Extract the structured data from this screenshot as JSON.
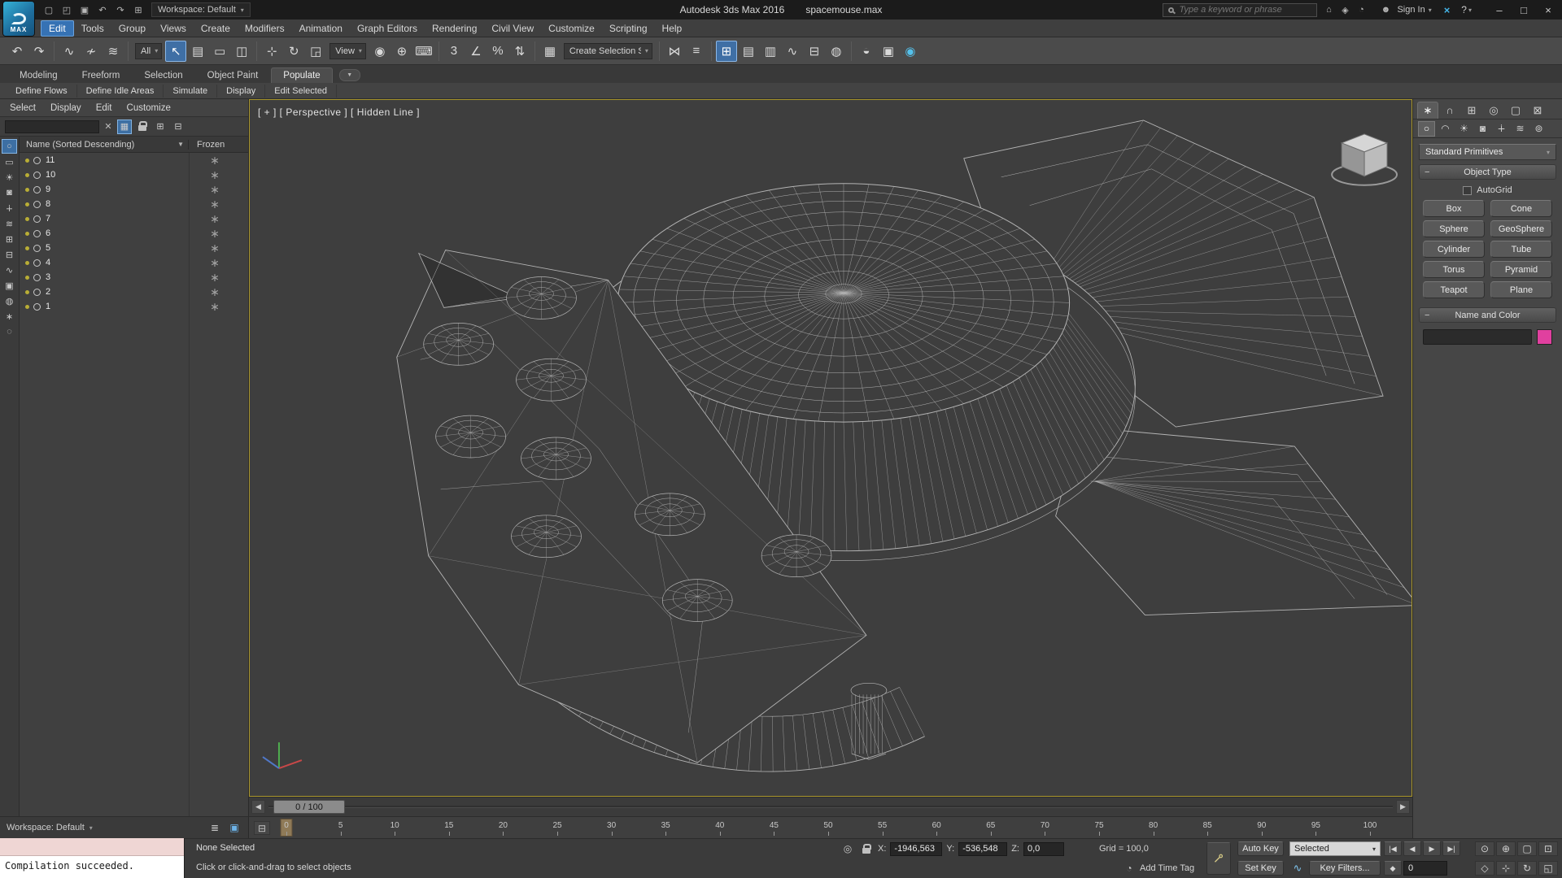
{
  "titlebar": {
    "logo_text": "MAX",
    "quick_icons": [
      {
        "name": "new-scene-icon",
        "glyph": "▢"
      },
      {
        "name": "open-file-icon",
        "glyph": "◰"
      },
      {
        "name": "save-file-icon",
        "glyph": "▣"
      },
      {
        "name": "undo-quick-icon",
        "glyph": "↶"
      },
      {
        "name": "redo-quick-icon",
        "glyph": "↷"
      },
      {
        "name": "project-folder-icon",
        "glyph": "⊞"
      }
    ],
    "workspace_label": "Workspace: Default",
    "app_title": "Autodesk 3ds Max 2016",
    "file_title": "spacemouse.max",
    "search_placeholder": "Type a keyword or phrase",
    "right_icons": [
      {
        "name": "home-icon",
        "glyph": "⌂"
      },
      {
        "name": "favorites-icon",
        "glyph": "◈"
      },
      {
        "name": "notifications-icon",
        "glyph": "◔"
      }
    ],
    "avatar_glyph": "☻",
    "sign_in": "Sign In",
    "feedback_icon": "×",
    "help_label": "?",
    "window_buttons": {
      "minimize": "–",
      "maximize": "□",
      "close": "×"
    }
  },
  "menubar": {
    "items": [
      {
        "label": "Edit",
        "active": true
      },
      {
        "label": "Tools"
      },
      {
        "label": "Group"
      },
      {
        "label": "Views"
      },
      {
        "label": "Create"
      },
      {
        "label": "Modifiers"
      },
      {
        "label": "Animation"
      },
      {
        "label": "Graph Editors"
      },
      {
        "label": "Rendering"
      },
      {
        "label": "Civil View"
      },
      {
        "label": "Customize"
      },
      {
        "label": "Scripting"
      },
      {
        "label": "Help"
      }
    ]
  },
  "toolbar": {
    "items": [
      {
        "type": "icon",
        "name": "undo-icon",
        "glyph": "↶"
      },
      {
        "type": "icon",
        "name": "redo-icon",
        "glyph": "↷"
      },
      {
        "type": "sep"
      },
      {
        "type": "icon",
        "name": "select-and-link-icon",
        "glyph": "∿"
      },
      {
        "type": "icon",
        "name": "unlink-selection-icon",
        "glyph": "≁"
      },
      {
        "type": "icon",
        "name": "bind-to-space-warp-icon",
        "glyph": "≋"
      },
      {
        "type": "sep"
      },
      {
        "type": "dropdown",
        "name": "selection-filter-dropdown",
        "value": "All"
      },
      {
        "type": "icon",
        "name": "select-object-icon",
        "glyph": "↖",
        "active": true
      },
      {
        "type": "icon",
        "name": "select-by-name-icon",
        "glyph": "▤"
      },
      {
        "type": "icon",
        "name": "selection-region-icon",
        "glyph": "▭"
      },
      {
        "type": "icon",
        "name": "window-crossing-icon",
        "glyph": "◫"
      },
      {
        "type": "sep"
      },
      {
        "type": "icon",
        "name": "select-and-move-icon",
        "glyph": "⊹"
      },
      {
        "type": "icon",
        "name": "select-and-rotate-icon",
        "glyph": "↻"
      },
      {
        "type": "icon",
        "name": "select-and-scale-icon",
        "glyph": "◲"
      },
      {
        "type": "dropdown",
        "name": "reference-coordinate-dropdown",
        "value": "View"
      },
      {
        "type": "icon",
        "name": "use-center-icon",
        "glyph": "◉"
      },
      {
        "type": "icon",
        "name": "select-and-manipulate-icon",
        "glyph": "⊕"
      },
      {
        "type": "icon",
        "name": "keyboard-override-icon",
        "glyph": "⌨"
      },
      {
        "type": "sep"
      },
      {
        "type": "icon",
        "name": "snap-toggle-3d-icon",
        "glyph": "3"
      },
      {
        "type": "icon",
        "name": "angle-snap-icon",
        "glyph": "∠"
      },
      {
        "type": "icon",
        "name": "percent-snap-icon",
        "glyph": "%"
      },
      {
        "type": "icon",
        "name": "spinner-snap-icon",
        "glyph": "⇅"
      },
      {
        "type": "sep"
      },
      {
        "type": "icon",
        "name": "edit-named-selections-icon",
        "glyph": "▦"
      },
      {
        "type": "combo",
        "name": "named-selection-combo",
        "value": "Create Selection Set"
      },
      {
        "type": "sep"
      },
      {
        "type": "icon",
        "name": "mirror-icon",
        "glyph": "⋈"
      },
      {
        "type": "icon",
        "name": "align-icon",
        "glyph": "≡"
      },
      {
        "type": "sep"
      },
      {
        "type": "icon",
        "name": "toggle-scene-explorer-icon",
        "glyph": "⊞",
        "active": true
      },
      {
        "type": "icon",
        "name": "layer-manager-icon",
        "glyph": "▤"
      },
      {
        "type": "icon",
        "name": "ribbon-toggle-icon",
        "glyph": "▥"
      },
      {
        "type": "icon",
        "name": "curve-editor-icon",
        "glyph": "∿"
      },
      {
        "type": "icon",
        "name": "schematic-view-icon",
        "glyph": "⊟"
      },
      {
        "type": "icon",
        "name": "material-editor-icon",
        "glyph": "◍"
      },
      {
        "type": "sep"
      },
      {
        "type": "icon",
        "name": "render-setup-icon",
        "glyph": "◒"
      },
      {
        "type": "icon",
        "name": "rendered-frame-icon",
        "glyph": "▣"
      },
      {
        "type": "icon",
        "name": "render-production-icon",
        "glyph": "◉",
        "accent": true
      }
    ]
  },
  "ribbon": {
    "tabs": [
      {
        "label": "Modeling"
      },
      {
        "label": "Freeform"
      },
      {
        "label": "Selection"
      },
      {
        "label": "Object Paint"
      },
      {
        "label": "Populate",
        "active": true
      }
    ],
    "tools": [
      {
        "label": "Define Flows"
      },
      {
        "label": "Define Idle Areas"
      },
      {
        "label": "Simulate"
      },
      {
        "label": "Display"
      },
      {
        "label": "Edit Selected"
      }
    ]
  },
  "scene_explorer": {
    "menus": [
      {
        "label": "Select"
      },
      {
        "label": "Display"
      },
      {
        "label": "Edit"
      },
      {
        "label": "Customize"
      }
    ],
    "search_placeholder": "",
    "clear_glyph": "✕",
    "name_column": "Name (Sorted Descending)",
    "frozen_column": "Frozen",
    "frozen_glyph": "∗",
    "rows": [
      {
        "label": "11"
      },
      {
        "label": "10"
      },
      {
        "label": "9"
      },
      {
        "label": "8"
      },
      {
        "label": "7"
      },
      {
        "label": "6"
      },
      {
        "label": "5"
      },
      {
        "label": "4"
      },
      {
        "label": "3"
      },
      {
        "label": "2"
      },
      {
        "label": "1"
      }
    ],
    "search_icons": [
      {
        "name": "find-filter-icon",
        "glyph": "▦",
        "active": true
      },
      {
        "name": "lock-explorer-icon",
        "glyph": "lock"
      },
      {
        "name": "add-filter-icon",
        "glyph": "⊞"
      },
      {
        "name": "remove-filter-icon",
        "glyph": "⊟"
      }
    ],
    "strip_icons": [
      {
        "name": "display-geometry-filter-icon",
        "glyph": "○",
        "active": true
      },
      {
        "name": "display-shapes-filter-icon",
        "glyph": "▭"
      },
      {
        "name": "display-lights-filter-icon",
        "glyph": "☀"
      },
      {
        "name": "display-cameras-filter-icon",
        "glyph": "◙"
      },
      {
        "name": "display-helpers-filter-icon",
        "glyph": "∔"
      },
      {
        "name": "display-spacewarps-filter-icon",
        "glyph": "≋"
      },
      {
        "name": "display-groups-filter-icon",
        "glyph": "⊞"
      },
      {
        "name": "display-xrefs-filter-icon",
        "glyph": "⊟"
      },
      {
        "name": "display-bones-filter-icon",
        "glyph": "∿"
      },
      {
        "name": "display-containers-filter-icon",
        "glyph": "▣"
      },
      {
        "name": "display-materials-filter-icon",
        "glyph": "◍"
      },
      {
        "name": "display-frozen-filter-icon",
        "glyph": "∗"
      },
      {
        "name": "display-hidden-filter-icon",
        "glyph": "◌"
      }
    ]
  },
  "viewport": {
    "label": "[ + ] [ Perspective ] [ Hidden Line ]"
  },
  "command_panel": {
    "tabs": [
      {
        "name": "create-tab-icon",
        "glyph": "∗",
        "active": true
      },
      {
        "name": "modify-tab-icon",
        "glyph": "∩"
      },
      {
        "name": "hierarchy-tab-icon",
        "glyph": "⊞"
      },
      {
        "name": "motion-tab-icon",
        "glyph": "◎"
      },
      {
        "name": "display-tab-icon",
        "glyph": "▢"
      },
      {
        "name": "utilities-tab-icon",
        "glyph": "⊠"
      }
    ],
    "categories": [
      {
        "name": "geometry-category-icon",
        "glyph": "○",
        "active": true
      },
      {
        "name": "shapes-category-icon",
        "glyph": "◠"
      },
      {
        "name": "lights-category-icon",
        "glyph": "☀"
      },
      {
        "name": "cameras-category-icon",
        "glyph": "◙"
      },
      {
        "name": "helpers-category-icon",
        "glyph": "∔"
      },
      {
        "name": "spacewarps-category-icon",
        "glyph": "≋"
      },
      {
        "name": "systems-category-icon",
        "glyph": "⊚"
      }
    ],
    "category_dropdown": "Standard Primitives",
    "object_type_rollout": "Object Type",
    "autogrid_label": "AutoGrid",
    "object_buttons": [
      {
        "label": "Box"
      },
      {
        "label": "Cone"
      },
      {
        "label": "Sphere"
      },
      {
        "label": "GeoSphere"
      },
      {
        "label": "Cylinder"
      },
      {
        "label": "Tube"
      },
      {
        "label": "Torus"
      },
      {
        "label": "Pyramid"
      },
      {
        "label": "Teapot"
      },
      {
        "label": "Plane"
      }
    ],
    "name_color_rollout": "Name and Color",
    "object_name_value": "",
    "color_swatch": "#e0409f"
  },
  "timeline": {
    "slider_label": "0 / 100",
    "ticks": [
      "0",
      "5",
      "10",
      "15",
      "20",
      "25",
      "30",
      "35",
      "40",
      "45",
      "50",
      "55",
      "60",
      "65",
      "70",
      "75",
      "80",
      "85",
      "90",
      "95",
      "100"
    ]
  },
  "status_bar": {
    "workspace_label": "Workspace: Default",
    "listener_output": "Compilation succeeded.",
    "selection_status": "None Selected",
    "prompt": "Click or click-and-drag to select objects",
    "x_label": "X:",
    "x_value": "-1946,563",
    "y_label": "Y:",
    "y_value": "-536,548",
    "z_label": "Z:",
    "z_value": "0,0",
    "grid_label": "Grid = 100,0",
    "add_time_tag": "Add Time Tag",
    "auto_key": "Auto Key",
    "set_key": "Set Key",
    "key_mode_value": "Selected",
    "key_filters": "Key Filters...",
    "time_value": "0",
    "playback_top": [
      {
        "name": "go-to-start-button",
        "glyph": "|◀"
      },
      {
        "name": "previous-frame-button",
        "glyph": "◀"
      },
      {
        "name": "play-button",
        "glyph": "▶"
      },
      {
        "name": "go-to-end-button",
        "glyph": "▶|"
      }
    ],
    "playback_bottom": [
      {
        "name": "key-mode-toggle-button",
        "glyph": "◆"
      }
    ],
    "nav_top": [
      {
        "name": "zoom-icon",
        "glyph": "⊙"
      },
      {
        "name": "zoom-all-icon",
        "glyph": "⊕"
      },
      {
        "name": "zoom-extents-icon",
        "glyph": "▢"
      },
      {
        "name": "zoom-region-icon",
        "glyph": "⊡"
      }
    ],
    "nav_bottom": [
      {
        "name": "field-of-view-icon",
        "glyph": "◇"
      },
      {
        "name": "pan-icon",
        "glyph": "⊹"
      },
      {
        "name": "orbit-icon",
        "glyph": "↻"
      },
      {
        "name": "maximize-viewport-icon",
        "glyph": "◱"
      }
    ]
  }
}
